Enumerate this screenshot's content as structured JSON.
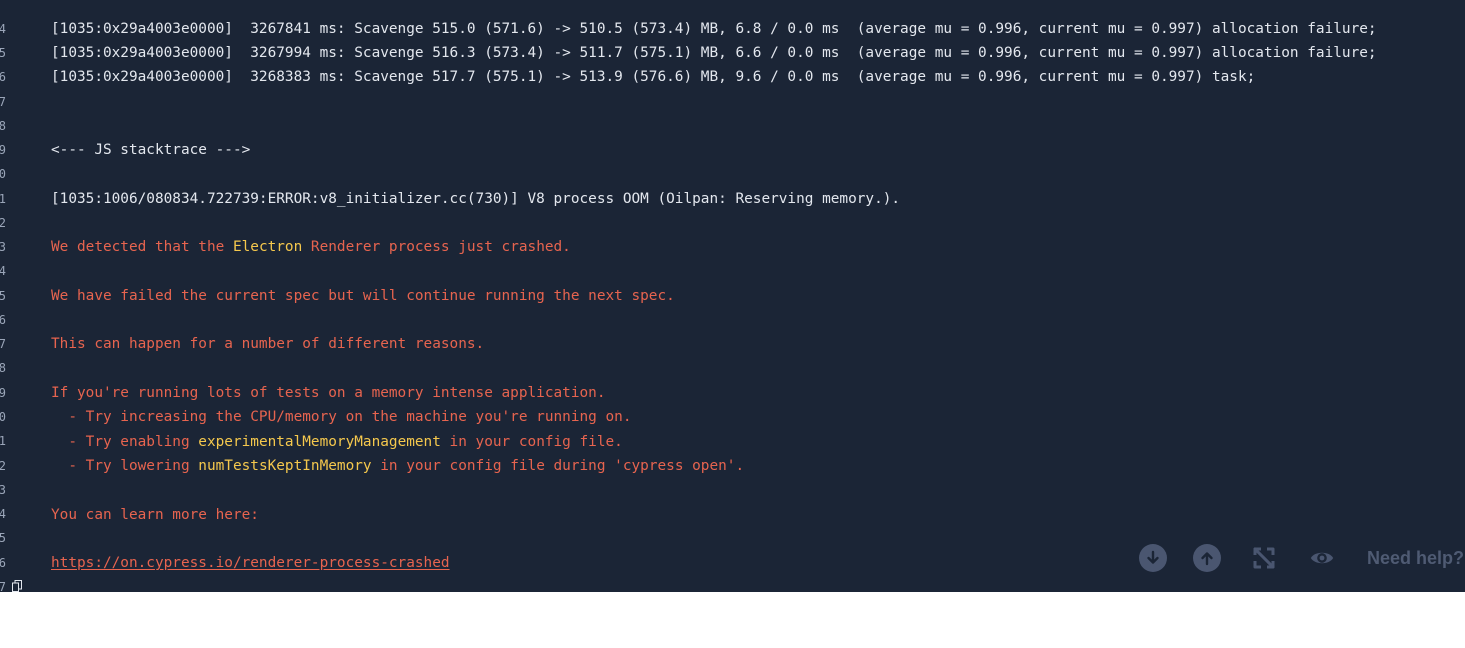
{
  "gutter": {
    "numbers": [
      "4",
      "5",
      "6",
      "7",
      "8",
      "9",
      "0",
      "1",
      "2",
      "3",
      "4",
      "5",
      "6",
      "7",
      "8",
      "9",
      "0",
      "1",
      "2",
      "3",
      "4",
      "5",
      "6",
      "7"
    ]
  },
  "log": {
    "gc_lines": [
      "[1035:0x29a4003e0000]  3267841 ms: Scavenge 515.0 (571.6) -> 510.5 (573.4) MB, 6.8 / 0.0 ms  (average mu = 0.996, current mu = 0.997) allocation failure;",
      "[1035:0x29a4003e0000]  3267994 ms: Scavenge 516.3 (573.4) -> 511.7 (575.1) MB, 6.6 / 0.0 ms  (average mu = 0.996, current mu = 0.997) allocation failure;",
      "[1035:0x29a4003e0000]  3268383 ms: Scavenge 517.7 (575.1) -> 513.9 (576.6) MB, 9.6 / 0.0 ms  (average mu = 0.996, current mu = 0.997) task;"
    ],
    "stacktrace_header": "<--- JS stacktrace --->",
    "oom_error": "[1035:1006/080834.722739:ERROR:v8_initializer.cc(730)] V8 process OOM (Oilpan: Reserving memory.)."
  },
  "crash": {
    "detected_pre": "We detected that the ",
    "detected_hl": "Electron",
    "detected_post": " Renderer process just crashed.",
    "failed_spec": "We have failed the current spec but will continue running the next spec.",
    "reasons": "This can happen for a number of different reasons.",
    "memory_intense": "If you're running lots of tests on a memory intense application.",
    "tip1": "  - Try increasing the CPU/memory on the machine you're running on.",
    "tip2_pre": "  - Try enabling ",
    "tip2_hl": "experimentalMemoryManagement",
    "tip2_post": " in your config file.",
    "tip3_pre": "  - Try lowering ",
    "tip3_hl": "numTestsKeptInMemory",
    "tip3_post": " in your config file during 'cypress open'.",
    "learn_more": "You can learn more here:",
    "link": "https://on.cypress.io/renderer-process-crashed"
  },
  "toolbar": {
    "scroll_down_icon": "arrow-down-circle-icon",
    "scroll_up_icon": "arrow-up-circle-icon",
    "expand_icon": "expand-icon",
    "view_icon": "eye-icon",
    "help_label": "Need help?"
  },
  "colors": {
    "background": "#1b2536",
    "text": "#e3e7ee",
    "error": "#e7644f",
    "highlight": "#f5c84d",
    "button": "#4a5670"
  }
}
